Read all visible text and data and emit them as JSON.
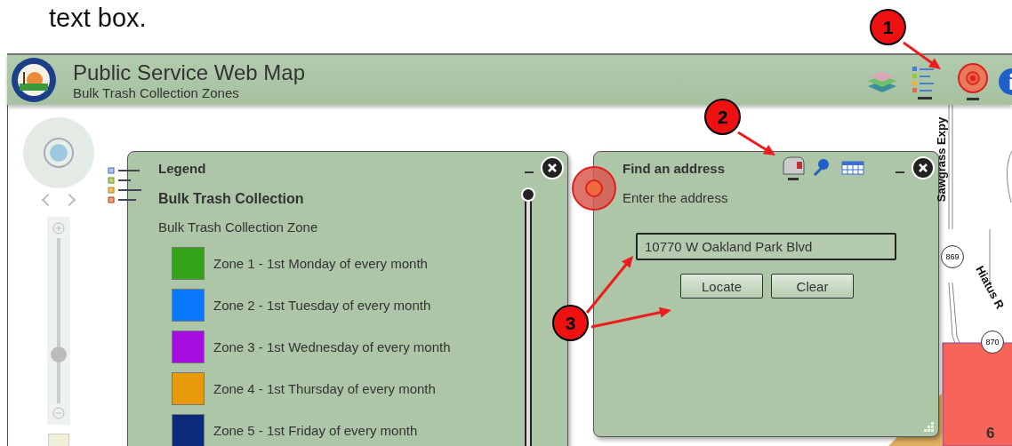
{
  "doc_text": "text box.",
  "header": {
    "title": "Public Service Web Map",
    "subtitle": "Bulk Trash Collection Zones"
  },
  "zoom": {
    "level": 0.25
  },
  "legend": {
    "title": "Legend",
    "layer": "Bulk Trash Collection",
    "group": "Bulk Trash Collection Zone",
    "items": [
      {
        "label": "Zone 1 - 1st Monday of every month",
        "color": "#33a31a"
      },
      {
        "label": "Zone 2 - 1st Tuesday of every month",
        "color": "#0a78ff"
      },
      {
        "label": "Zone 3 - 1st Wednesday of every month",
        "color": "#a40ee0"
      },
      {
        "label": "Zone 4 - 1st Thursday of every month",
        "color": "#e89a0c"
      },
      {
        "label": "Zone 5 - 1st Friday of every month",
        "color": "#0a2a7a"
      }
    ]
  },
  "find": {
    "title": "Find an address",
    "prompt": "Enter the address",
    "value": "10770 W Oakland Park Blvd",
    "buttons": [
      "Locate",
      "Clear"
    ]
  },
  "map": {
    "road_labels": [
      "Sawgrass Expy",
      "Hiatus R"
    ],
    "shields": [
      "869",
      "870"
    ],
    "zone_number": "6"
  },
  "callouts": [
    {
      "number": "1"
    },
    {
      "number": "2"
    },
    {
      "number": "3"
    }
  ]
}
